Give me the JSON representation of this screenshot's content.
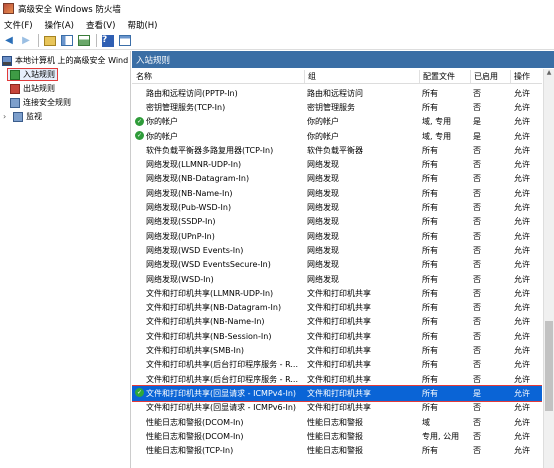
{
  "window": {
    "title": "高级安全 Windows 防火墙"
  },
  "menu": [
    "文件(F)",
    "操作(A)",
    "查看(V)",
    "帮助(H)"
  ],
  "toolbar": {
    "icons": [
      "back-arrow-icon",
      "forward-arrow-icon",
      "folder-up-icon",
      "show-tree-icon",
      "properties-icon",
      "help-icon",
      "action-pane-icon"
    ]
  },
  "tree": {
    "root": "本地计算机 上的高级安全 Wind",
    "items": [
      {
        "label": "入站规则",
        "selected": true
      },
      {
        "label": "出站规则",
        "selected": false
      },
      {
        "label": "连接安全规则",
        "selected": false
      },
      {
        "label": "监视",
        "selected": false
      }
    ]
  },
  "pane": {
    "title": "入站规则"
  },
  "columns": {
    "name": "名称",
    "group": "组",
    "profile": "配置文件",
    "enabled": "已启用",
    "action": "操作"
  },
  "rules": [
    {
      "name": "路由和远程访问(PPTP-In)",
      "group": "路由和远程访问",
      "profile": "所有",
      "enabled": "否",
      "action": "允许",
      "checked": false
    },
    {
      "name": "密钥管理服务(TCP-In)",
      "group": "密钥管理服务",
      "profile": "所有",
      "enabled": "否",
      "action": "允许",
      "checked": false
    },
    {
      "name": "你的帐户",
      "group": "你的帐户",
      "profile": "域, 专用",
      "enabled": "是",
      "action": "允许",
      "checked": true
    },
    {
      "name": "你的帐户",
      "group": "你的帐户",
      "profile": "域, 专用",
      "enabled": "是",
      "action": "允许",
      "checked": true
    },
    {
      "name": "软件负载平衡器多路复用器(TCP-In)",
      "group": "软件负载平衡器",
      "profile": "所有",
      "enabled": "否",
      "action": "允许",
      "checked": false
    },
    {
      "name": "网络发现(LLMNR-UDP-In)",
      "group": "网络发现",
      "profile": "所有",
      "enabled": "否",
      "action": "允许",
      "checked": false
    },
    {
      "name": "网络发现(NB-Datagram-In)",
      "group": "网络发现",
      "profile": "所有",
      "enabled": "否",
      "action": "允许",
      "checked": false
    },
    {
      "name": "网络发现(NB-Name-In)",
      "group": "网络发现",
      "profile": "所有",
      "enabled": "否",
      "action": "允许",
      "checked": false
    },
    {
      "name": "网络发现(Pub-WSD-In)",
      "group": "网络发现",
      "profile": "所有",
      "enabled": "否",
      "action": "允许",
      "checked": false
    },
    {
      "name": "网络发现(SSDP-In)",
      "group": "网络发现",
      "profile": "所有",
      "enabled": "否",
      "action": "允许",
      "checked": false
    },
    {
      "name": "网络发现(UPnP-In)",
      "group": "网络发现",
      "profile": "所有",
      "enabled": "否",
      "action": "允许",
      "checked": false
    },
    {
      "name": "网络发现(WSD Events-In)",
      "group": "网络发现",
      "profile": "所有",
      "enabled": "否",
      "action": "允许",
      "checked": false
    },
    {
      "name": "网络发现(WSD EventsSecure-In)",
      "group": "网络发现",
      "profile": "所有",
      "enabled": "否",
      "action": "允许",
      "checked": false
    },
    {
      "name": "网络发现(WSD-In)",
      "group": "网络发现",
      "profile": "所有",
      "enabled": "否",
      "action": "允许",
      "checked": false
    },
    {
      "name": "文件和打印机共享(LLMNR-UDP-In)",
      "group": "文件和打印机共享",
      "profile": "所有",
      "enabled": "否",
      "action": "允许",
      "checked": false
    },
    {
      "name": "文件和打印机共享(NB-Datagram-In)",
      "group": "文件和打印机共享",
      "profile": "所有",
      "enabled": "否",
      "action": "允许",
      "checked": false
    },
    {
      "name": "文件和打印机共享(NB-Name-In)",
      "group": "文件和打印机共享",
      "profile": "所有",
      "enabled": "否",
      "action": "允许",
      "checked": false
    },
    {
      "name": "文件和打印机共享(NB-Session-In)",
      "group": "文件和打印机共享",
      "profile": "所有",
      "enabled": "否",
      "action": "允许",
      "checked": false
    },
    {
      "name": "文件和打印机共享(SMB-In)",
      "group": "文件和打印机共享",
      "profile": "所有",
      "enabled": "否",
      "action": "允许",
      "checked": false
    },
    {
      "name": "文件和打印机共享(后台打印程序服务 - R...",
      "group": "文件和打印机共享",
      "profile": "所有",
      "enabled": "否",
      "action": "允许",
      "checked": false
    },
    {
      "name": "文件和打印机共享(后台打印程序服务 - R...",
      "group": "文件和打印机共享",
      "profile": "所有",
      "enabled": "否",
      "action": "允许",
      "checked": false
    },
    {
      "name": "文件和打印机共享(回显请求 - ICMPv4-In)",
      "group": "文件和打印机共享",
      "profile": "所有",
      "enabled": "是",
      "action": "允许",
      "checked": true,
      "selected": true
    },
    {
      "name": "文件和打印机共享(回显请求 - ICMPv6-In)",
      "group": "文件和打印机共享",
      "profile": "所有",
      "enabled": "否",
      "action": "允许",
      "checked": false
    },
    {
      "name": "性能日志和警报(DCOM-In)",
      "group": "性能日志和警报",
      "profile": "域",
      "enabled": "否",
      "action": "允许",
      "checked": false
    },
    {
      "name": "性能日志和警报(DCOM-In)",
      "group": "性能日志和警报",
      "profile": "专用, 公用",
      "enabled": "否",
      "action": "允许",
      "checked": false
    },
    {
      "name": "性能日志和警报(TCP-In)",
      "group": "性能日志和警报",
      "profile": "所有",
      "enabled": "否",
      "action": "允许",
      "checked": false
    }
  ]
}
